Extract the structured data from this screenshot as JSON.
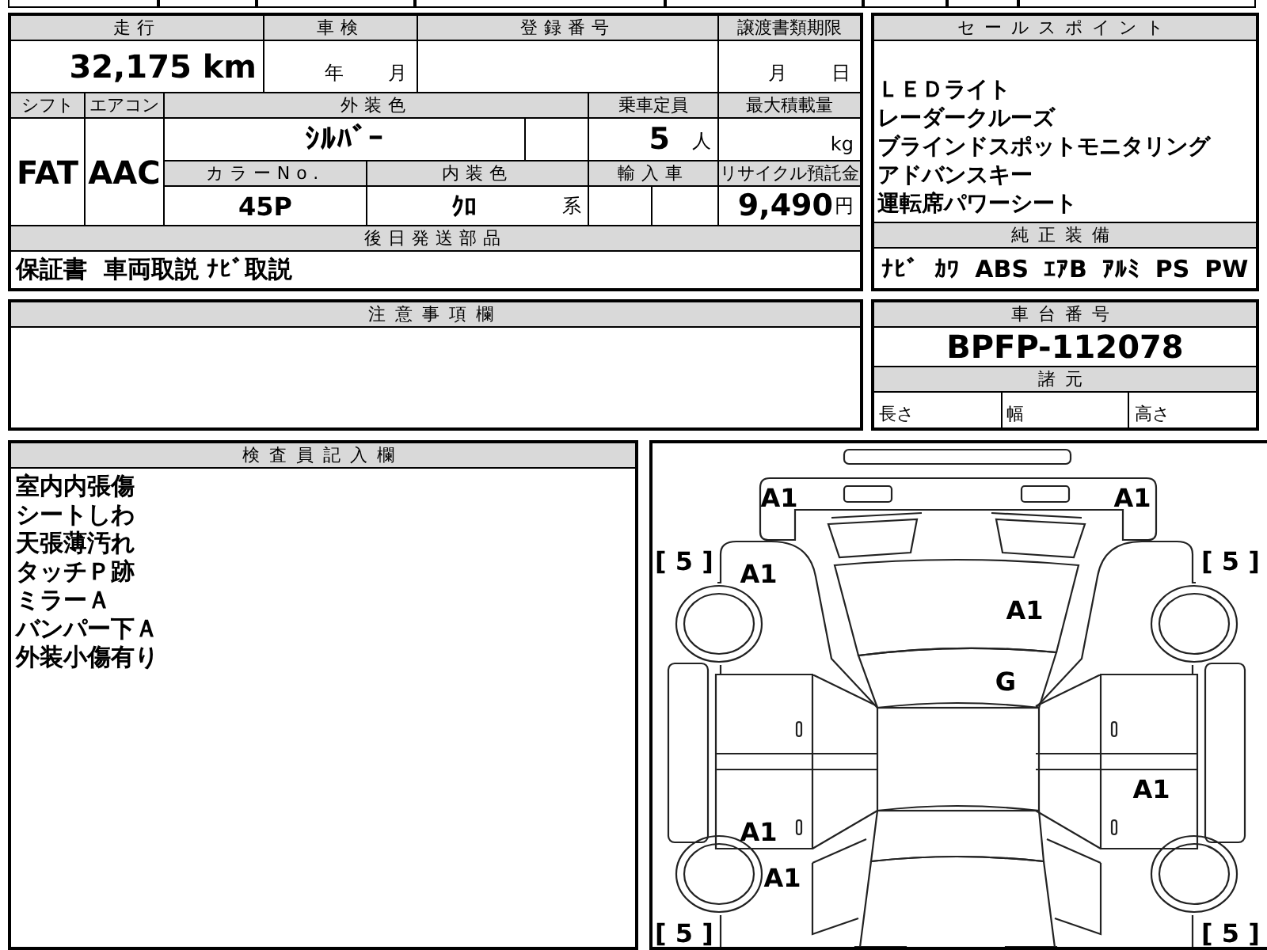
{
  "vehicle_table": {
    "mileage": {
      "label": "走行",
      "value": "32,175 km"
    },
    "inspection": {
      "label": "車検",
      "year_unit": "年",
      "month_unit": "月"
    },
    "registration_number": {
      "label": "登録番号"
    },
    "transfer_deadline": {
      "label": "譲渡書類期限",
      "month_unit": "月",
      "day_unit": "日"
    },
    "shift": {
      "label": "シフト",
      "value": "FAT"
    },
    "air_conditioner": {
      "label": "エアコン",
      "value": "AAC"
    },
    "exterior_color": {
      "label": "外装色",
      "value": "ｼﾙﾊﾞｰ"
    },
    "capacity": {
      "label": "乗車定員",
      "value": "5",
      "unit": "人"
    },
    "max_load": {
      "label": "最大積載量",
      "unit": "kg"
    },
    "color_number": {
      "label": "カラーNo.",
      "value": "45P"
    },
    "interior_color": {
      "label": "内装色",
      "value": "ｸﾛ",
      "suffix": "系"
    },
    "imported": {
      "label": "輸入車"
    },
    "recycle_deposit": {
      "label": "リサイクル預託金",
      "value": "9,490",
      "unit": "円"
    },
    "parts_to_ship": {
      "label": "後日発送部品",
      "value": "保証書  車両取説 ﾅﾋﾞ取説"
    }
  },
  "sales_points": {
    "label": "セールスポイント",
    "items": [
      "ＬＥＤライト",
      "レーダークルーズ",
      "ブラインドスポットモニタリング",
      "アドバンスキー",
      "運転席パワーシート"
    ]
  },
  "genuine_equipment": {
    "label": "純正装備",
    "items": [
      "ﾅﾋﾞ",
      "ｶﾜ",
      "ABS",
      "ｴｱB",
      "ｱﾙﾐ",
      "PS",
      "PW"
    ]
  },
  "notes": {
    "label": "注意事項欄"
  },
  "chassis": {
    "label": "車台番号",
    "value": "BPFP-112078",
    "specs_label": "諸元",
    "specs": [
      "長さ",
      "幅",
      "高さ"
    ]
  },
  "inspector_notes": {
    "label": "検査員記入欄",
    "lines": [
      "室内内張傷",
      "シートしわ",
      "天張薄汚れ",
      "タッチＰ跡",
      "ミラーＡ",
      "バンパー下Ａ",
      "外装小傷有り"
    ]
  },
  "damage_diagram": {
    "marks": [
      "A1",
      "A1",
      "A1",
      "A1",
      "G",
      "A1",
      "A1",
      "A1"
    ],
    "tread_depths": [
      "[ 5 ]",
      "[ 5 ]",
      "[ 5 ]",
      "[ 5 ]"
    ]
  }
}
